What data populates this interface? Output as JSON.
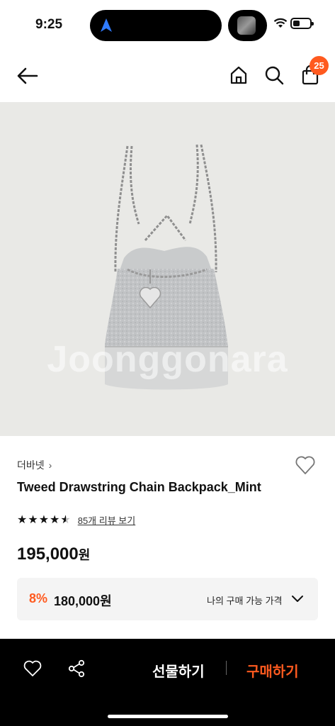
{
  "status_bar": {
    "time": "9:25",
    "icons": [
      "navigation-arrow-icon",
      "media-thumbnail",
      "wifi-icon",
      "battery-icon"
    ]
  },
  "header": {
    "icons": [
      "back-arrow-icon",
      "home-icon",
      "search-icon",
      "shopping-bag-icon"
    ],
    "cart_count": "25"
  },
  "product_image": {
    "watermark": "Joonggonara"
  },
  "product": {
    "brand": "더바넷",
    "brand_chevron": "›",
    "title": "Tweed Drawstring Chain Backpack_Mint",
    "rating_value": 4.5,
    "rating_max": 5,
    "review_link": "85개 리뷰 보기",
    "price": "195,000",
    "price_unit": "원"
  },
  "discount": {
    "rate": "8%",
    "price": "180,000원",
    "label": "나의 구매 가능 가격"
  },
  "bottom_bar": {
    "gift_label": "선물하기",
    "buy_label": "구매하기",
    "accent_color": "#ff5a1f"
  }
}
